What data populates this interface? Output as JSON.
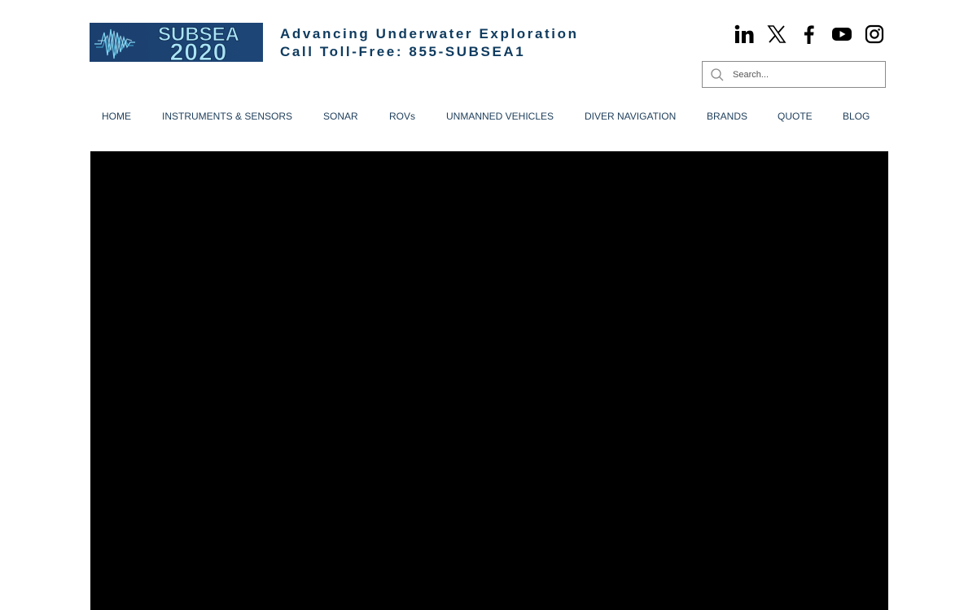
{
  "logo": {
    "top_text": "SUBSEA",
    "bottom_text": "2020"
  },
  "header": {
    "tagline": "Advancing Underwater Exploration",
    "phone": "Call Toll-Free: 855-SUBSEA1"
  },
  "social": [
    {
      "icon": "linkedin-icon",
      "label": "in"
    },
    {
      "icon": "x-icon"
    },
    {
      "icon": "facebook-icon"
    },
    {
      "icon": "youtube-icon"
    },
    {
      "icon": "instagram-icon"
    }
  ],
  "search": {
    "placeholder": "Search...",
    "value": ""
  },
  "nav": {
    "items": [
      {
        "label": "HOME"
      },
      {
        "label": "INSTRUMENTS & SENSORS"
      },
      {
        "label": "SONAR"
      },
      {
        "label": "ROVs"
      },
      {
        "label": "UNMANNED VEHICLES"
      },
      {
        "label": "DIVER NAVIGATION"
      },
      {
        "label": "BRANDS"
      },
      {
        "label": "QUOTE"
      },
      {
        "label": "BLOG"
      }
    ]
  },
  "colors": {
    "brand_text": "#0f3b5f",
    "nav_text": "#1e3e5b",
    "logo_bg": "#1b3f6e",
    "logo_text": "#9fdcf5",
    "video_bg": "#000000"
  }
}
